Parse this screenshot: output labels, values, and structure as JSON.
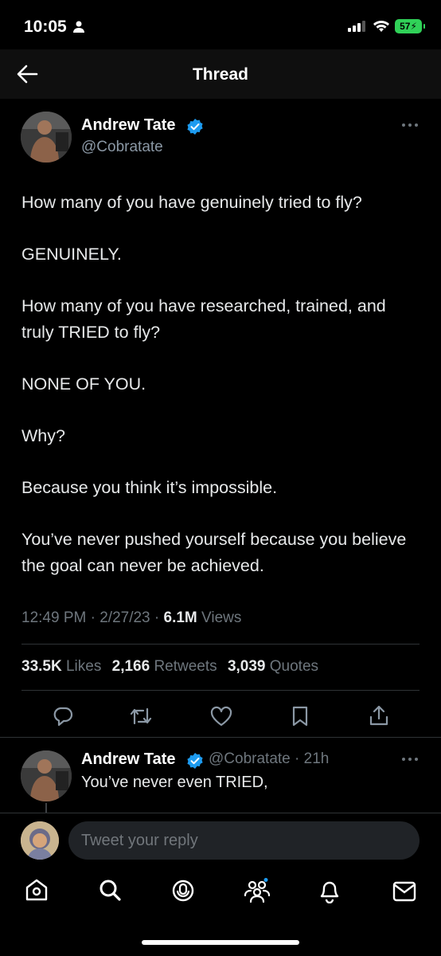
{
  "status_bar": {
    "time": "10:05",
    "battery": "57"
  },
  "header": {
    "title": "Thread"
  },
  "tweet": {
    "author_name": "Andrew Tate",
    "author_handle": "@Cobratate",
    "paragraphs": [
      "How many of you have genuinely tried to fly?",
      "GENUINELY.",
      "How many of you have researched, trained, and truly TRIED to fly?",
      "NONE OF YOU.",
      "Why?",
      "Because you think it’s impossible.",
      "You’ve never pushed yourself because you believe the goal can never be achieved."
    ],
    "time": "12:49 PM",
    "date": "2/27/23",
    "views_count": "6.1M",
    "views_label": "Views",
    "likes_count": "33.5K",
    "likes_label": "Likes",
    "retweets_count": "2,166",
    "retweets_label": "Retweets",
    "quotes_count": "3,039",
    "quotes_label": "Quotes"
  },
  "actions": [
    "reply-icon",
    "retweet-icon",
    "like-icon",
    "bookmark-icon",
    "share-icon"
  ],
  "reply": {
    "author_name": "Andrew Tate",
    "author_handle": "@Cobratate",
    "age": "21h",
    "text": "You’ve never even TRIED,"
  },
  "compose": {
    "placeholder": "Tweet your reply"
  },
  "tabbar": [
    "home-icon",
    "search-icon",
    "spaces-icon",
    "communities-icon",
    "notifications-icon",
    "messages-icon"
  ],
  "colors": {
    "background": "#000000",
    "accent": "#1d9bf0",
    "muted": "#71767b",
    "battery": "#30d158"
  }
}
